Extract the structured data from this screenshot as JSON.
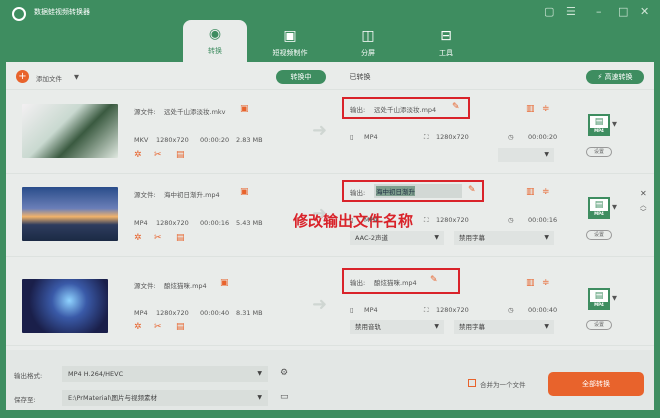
{
  "app": {
    "title": "数据蛙视频转换器"
  },
  "tabs": [
    {
      "label": "转换",
      "icon": "convert-icon",
      "active": true
    },
    {
      "label": "短视频制作",
      "icon": "tv-icon"
    },
    {
      "label": "分屏",
      "icon": "split-screen-icon"
    },
    {
      "label": "工具",
      "icon": "toolbox-icon"
    }
  ],
  "toolbar": {
    "add_file": "添加文件",
    "converting": "转换中",
    "converted": "已转换",
    "fast_convert": "高速转换"
  },
  "annotation": "修改输出文件名称",
  "labels": {
    "source": "源文件:",
    "output": "输出:",
    "settings": "设置"
  },
  "files": [
    {
      "source_name": "远处千山添淡妆.mkv",
      "format": "MKV",
      "resolution": "1280x720",
      "duration": "00:00:20",
      "size": "2.83 MB",
      "output_name": "远处千山添淡妆.mp4",
      "out_format": "MP4",
      "out_resolution": "1280x720",
      "out_duration": "00:00:20",
      "audio": "",
      "subtitle": "",
      "out_badge": "MP4"
    },
    {
      "source_name": "海中初日渐升.mp4",
      "format": "MP4",
      "resolution": "1280x720",
      "duration": "00:00:16",
      "size": "5.43 MB",
      "output_name": "海中初日渐升",
      "out_format": "MP4",
      "out_resolution": "1280x720",
      "out_duration": "00:00:16",
      "audio": "AAC-2声道",
      "subtitle": "禁用字幕",
      "out_badge": "MP4"
    },
    {
      "source_name": "酿炫猫咪.mp4",
      "format": "MP4",
      "resolution": "1280x720",
      "duration": "00:00:40",
      "size": "8.31 MB",
      "output_name": "酿炫猫咪.mp4",
      "out_format": "MP4",
      "out_resolution": "1280x720",
      "out_duration": "00:00:40",
      "audio": "禁用音轨",
      "subtitle": "禁用字幕",
      "out_badge": "MP4"
    }
  ],
  "bottom": {
    "format_label": "输出格式:",
    "format_value": "MP4 H.264/HEVC",
    "save_label": "保存至:",
    "save_path": "E:\\PrMaterial\\图片与视频素材",
    "merge_label": "合并为一个文件",
    "convert_all": "全部转换"
  },
  "colors": {
    "brand": "#3e8d60",
    "accent": "#e8632c",
    "annotation": "#d9232a"
  }
}
